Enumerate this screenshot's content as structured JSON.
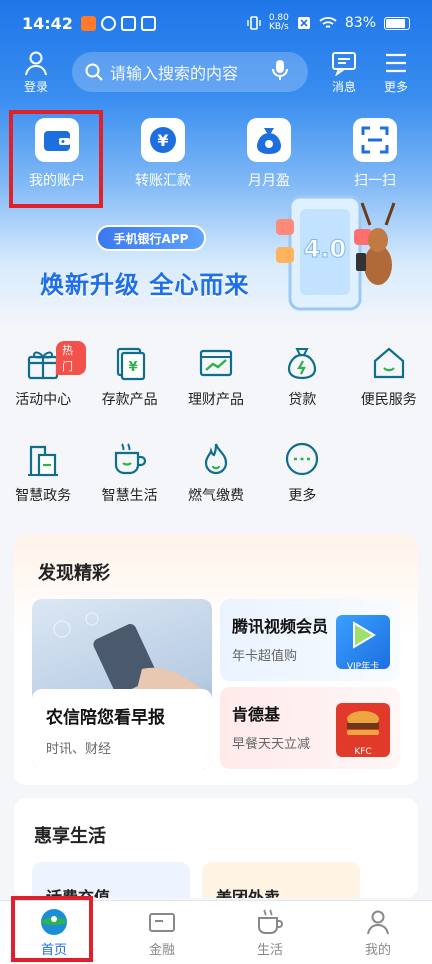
{
  "status": {
    "time": "14:42",
    "speed_top": "0.80",
    "speed_unit": "KB/s",
    "battery": "83%"
  },
  "header": {
    "login_label": "登录",
    "search_placeholder": "请输入搜索的内容",
    "messages_label": "消息",
    "more_label": "更多"
  },
  "quick": [
    {
      "label": "我的账户",
      "icon": "wallet-icon"
    },
    {
      "label": "转账汇款",
      "icon": "yuan-transfer-icon"
    },
    {
      "label": "月月盈",
      "icon": "money-bag-icon"
    },
    {
      "label": "扫一扫",
      "icon": "scan-icon"
    }
  ],
  "banner": {
    "pill": "手机银行APP",
    "title": "焕新升级  全心而来",
    "version": "4.0"
  },
  "services": [
    {
      "label": "活动中心",
      "icon": "gift-icon",
      "badge": "热门"
    },
    {
      "label": "存款产品",
      "icon": "deposit-icon"
    },
    {
      "label": "理财产品",
      "icon": "chart-icon"
    },
    {
      "label": "贷款",
      "icon": "loan-icon"
    },
    {
      "label": "便民服务",
      "icon": "home-icon"
    },
    {
      "label": "智慧政务",
      "icon": "government-icon"
    },
    {
      "label": "智慧生活",
      "icon": "cup-icon"
    },
    {
      "label": "燃气缴费",
      "icon": "flame-icon"
    },
    {
      "label": "更多",
      "icon": "more-dots-icon"
    }
  ],
  "discover": {
    "title": "发现精彩",
    "news": {
      "title": "农信陪您看早报",
      "sub": "时讯、财经"
    },
    "tv": {
      "title": "腾讯视频会员",
      "sub": "年卡超值购",
      "thumb_label": "VIP年卡"
    },
    "kfc": {
      "title": "肯德基",
      "sub": "早餐天天立减",
      "thumb_label": "KFC"
    }
  },
  "life": {
    "title": "惠享生活",
    "card1": "话费充值",
    "card2": "美团外卖"
  },
  "nav": [
    {
      "label": "首页",
      "active": true
    },
    {
      "label": "金融"
    },
    {
      "label": "生活"
    },
    {
      "label": "我的"
    }
  ]
}
